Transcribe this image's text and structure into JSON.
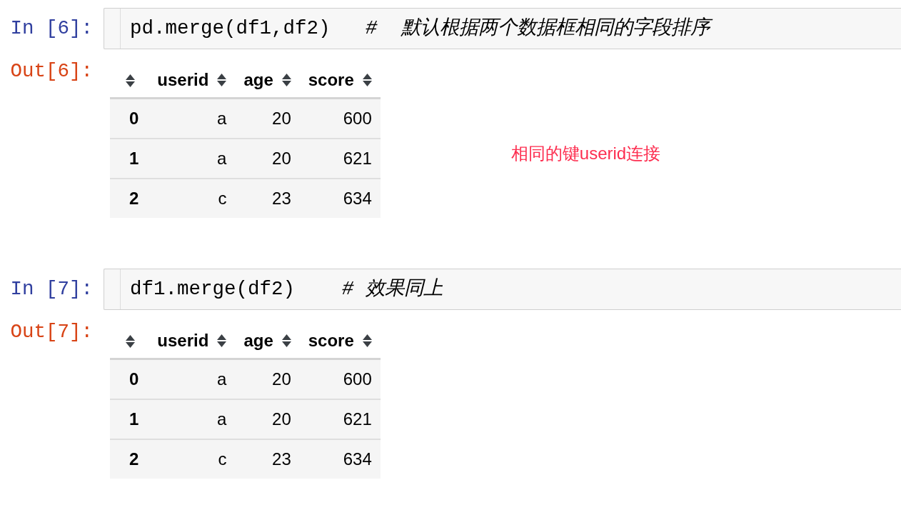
{
  "cells": [
    {
      "input_prompt": "In [6]:",
      "source": "pd.merge(df1,df2)   *#  默认根据两个数据框相同的字段排序*",
      "output_prompt": "Out[6]:",
      "table": {
        "columns": [
          "userid",
          "age",
          "score"
        ],
        "rows": [
          {
            "index": "0",
            "cells": [
              "a",
              "20",
              "600"
            ]
          },
          {
            "index": "1",
            "cells": [
              "a",
              "20",
              "621"
            ]
          },
          {
            "index": "2",
            "cells": [
              "c",
              "23",
              "634"
            ]
          }
        ]
      },
      "note": "相同的键userid连接"
    },
    {
      "input_prompt": "In [7]:",
      "source": "df1.merge(df2)    *# 效果同上*",
      "output_prompt": "Out[7]:",
      "table": {
        "columns": [
          "userid",
          "age",
          "score"
        ],
        "rows": [
          {
            "index": "0",
            "cells": [
              "a",
              "20",
              "600"
            ]
          },
          {
            "index": "1",
            "cells": [
              "a",
              "20",
              "621"
            ]
          },
          {
            "index": "2",
            "cells": [
              "c",
              "23",
              "634"
            ]
          }
        ]
      }
    }
  ]
}
